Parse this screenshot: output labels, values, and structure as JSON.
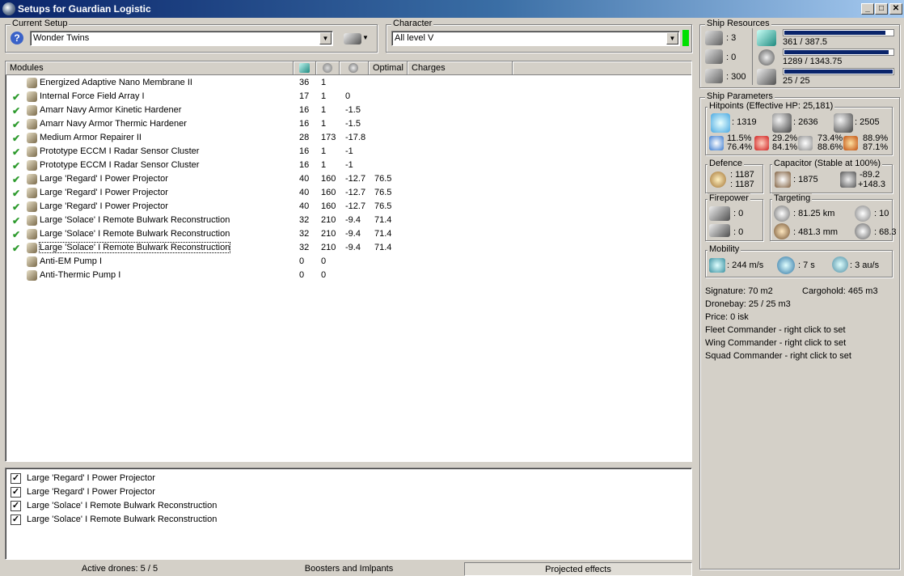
{
  "window": {
    "title": "Setups for Guardian Logistic",
    "min": "_",
    "max": "□",
    "close": "✕"
  },
  "current_setup": {
    "label": "Current Setup",
    "value": "Wonder Twins"
  },
  "character": {
    "label": "Character",
    "value": "All level V"
  },
  "modules": {
    "headers": {
      "name": "Modules",
      "optimal": "Optimal",
      "charges": "Charges"
    },
    "rows": [
      {
        "checked": false,
        "name": "Energized Adaptive Nano Membrane II",
        "cpu": "36",
        "pg": "1",
        "cap": "",
        "optimal": ""
      },
      {
        "checked": true,
        "name": "Internal Force Field Array I",
        "cpu": "17",
        "pg": "1",
        "cap": "0",
        "optimal": ""
      },
      {
        "checked": true,
        "name": "Amarr Navy Armor Kinetic Hardener",
        "cpu": "16",
        "pg": "1",
        "cap": "-1.5",
        "optimal": ""
      },
      {
        "checked": true,
        "name": "Amarr Navy Armor Thermic Hardener",
        "cpu": "16",
        "pg": "1",
        "cap": "-1.5",
        "optimal": ""
      },
      {
        "checked": true,
        "name": "Medium Armor Repairer II",
        "cpu": "28",
        "pg": "173",
        "cap": "-17.8",
        "optimal": ""
      },
      {
        "checked": true,
        "name": "Prototype ECCM I Radar Sensor Cluster",
        "cpu": "16",
        "pg": "1",
        "cap": "-1",
        "optimal": ""
      },
      {
        "checked": true,
        "name": "Prototype ECCM I Radar Sensor Cluster",
        "cpu": "16",
        "pg": "1",
        "cap": "-1",
        "optimal": ""
      },
      {
        "checked": true,
        "name": "Large 'Regard' I Power Projector",
        "cpu": "40",
        "pg": "160",
        "cap": "-12.7",
        "optimal": "76.5"
      },
      {
        "checked": true,
        "name": "Large 'Regard' I Power Projector",
        "cpu": "40",
        "pg": "160",
        "cap": "-12.7",
        "optimal": "76.5"
      },
      {
        "checked": true,
        "name": "Large 'Regard' I Power Projector",
        "cpu": "40",
        "pg": "160",
        "cap": "-12.7",
        "optimal": "76.5"
      },
      {
        "checked": true,
        "name": "Large 'Solace' I Remote Bulwark Reconstruction",
        "cpu": "32",
        "pg": "210",
        "cap": "-9.4",
        "optimal": "71.4"
      },
      {
        "checked": true,
        "name": "Large 'Solace' I Remote Bulwark Reconstruction",
        "cpu": "32",
        "pg": "210",
        "cap": "-9.4",
        "optimal": "71.4"
      },
      {
        "checked": true,
        "name": "Large 'Solace' I Remote Bulwark Reconstruction",
        "cpu": "32",
        "pg": "210",
        "cap": "-9.4",
        "optimal": "71.4"
      },
      {
        "checked": false,
        "name": "Anti-EM Pump I",
        "cpu": "0",
        "pg": "0",
        "cap": "",
        "optimal": ""
      },
      {
        "checked": false,
        "name": "Anti-Thermic Pump I",
        "cpu": "0",
        "pg": "0",
        "cap": "",
        "optimal": ""
      }
    ]
  },
  "projected": {
    "rows": [
      "Large 'Regard' I Power Projector",
      "Large 'Regard' I Power Projector",
      "Large 'Solace' I Remote Bulwark Reconstruction",
      "Large 'Solace' I Remote Bulwark Reconstruction"
    ],
    "checkmark": "✓"
  },
  "bottom_tabs": {
    "drones": "Active drones: 5 / 5",
    "boosters": "Boosters and Imlpants",
    "projected": "Projected effects"
  },
  "ship_resources": {
    "label": "Ship Resources",
    "turrets": ": 3",
    "launchers": ": 0",
    "calibration": ": 300",
    "cpu_text": "361 / 387.5",
    "cpu_fraction": 0.93,
    "pg_text": "1289 / 1343.75",
    "pg_fraction": 0.96,
    "drone_text": "25 / 25",
    "drone_fraction": 1.0
  },
  "ship_parameters": {
    "label": "Ship Parameters",
    "hitpoints": {
      "label": "Hitpoints (Effective HP: 25,181)",
      "shield": ": 1319",
      "armor": ": 2636",
      "structure": ": 2505",
      "res_em_shield": "11.5%",
      "res_em_armor": "76.4%",
      "res_th_shield": "29.2%",
      "res_th_armor": "84.1%",
      "res_kin_shield": "73.4%",
      "res_kin_armor": "88.6%",
      "res_exp_shield": "88.9%",
      "res_exp_armor": "87.1%"
    },
    "defence": {
      "label": "Defence",
      "line1": ": 1187",
      "line2": ": 1187"
    },
    "capacitor": {
      "label": "Capacitor (Stable at 100%)",
      "capacity": ": 1875",
      "delta_neg": "-89.2",
      "delta_pos": "+148.3"
    },
    "firepower": {
      "label": "Firepower",
      "line1": ": 0",
      "line2": ": 0"
    },
    "targeting": {
      "label": "Targeting",
      "range": ": 81.25 km",
      "targets": ": 10",
      "scan_res": ": 481.3 mm",
      "sensor": ": 68.3"
    },
    "mobility": {
      "label": "Mobility",
      "speed": ": 244 m/s",
      "align": ": 7 s",
      "warp": ": 3 au/s"
    },
    "signature": "Signature: 70 m2",
    "cargohold": "Cargohold: 465 m3",
    "dronebay": "Dronebay: 25 / 25 m3",
    "price": "Price: 0 isk",
    "fleet": "Fleet Commander - right click to set",
    "wing": "Wing Commander - right click to set",
    "squad": "Squad Commander - right click to set"
  },
  "colors": {
    "titlebar": "#0a246a",
    "check": "#2e9b2e",
    "bar": "#0a246a",
    "status_green": "#00e000"
  }
}
